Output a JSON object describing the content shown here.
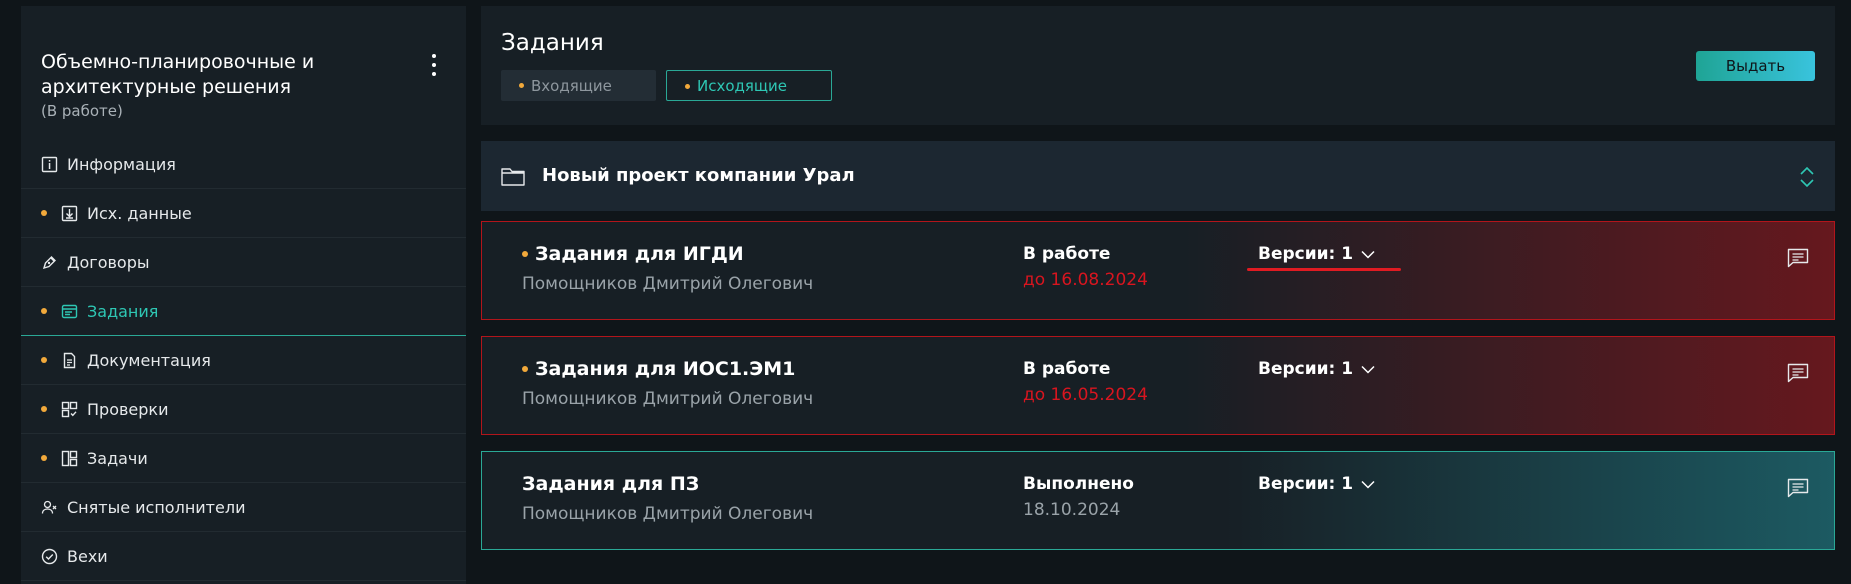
{
  "sidebar": {
    "title": "Объемно-планировочные и архитектурные решения",
    "status": "(В работе)",
    "items": [
      {
        "label": "Информация",
        "dot": false,
        "icon": "info-icon",
        "active": false
      },
      {
        "label": "Исх. данные",
        "dot": true,
        "icon": "download-icon",
        "active": false
      },
      {
        "label": "Договоры",
        "dot": false,
        "icon": "pen-icon",
        "active": false
      },
      {
        "label": "Задания",
        "dot": true,
        "icon": "tasks-window-icon",
        "active": true
      },
      {
        "label": "Документация",
        "dot": true,
        "icon": "document-icon",
        "active": false
      },
      {
        "label": "Проверки",
        "dot": true,
        "icon": "grid-check-icon",
        "active": false
      },
      {
        "label": "Задачи",
        "dot": true,
        "icon": "board-icon",
        "active": false
      },
      {
        "label": "Снятые исполнители",
        "dot": false,
        "icon": "user-remove-icon",
        "active": false
      },
      {
        "label": "Вехи",
        "dot": false,
        "icon": "check-circle-icon",
        "active": false
      }
    ]
  },
  "header": {
    "title": "Задания",
    "tabs": [
      {
        "label": "Входящие",
        "active": false
      },
      {
        "label": "Исходящие",
        "active": true
      }
    ],
    "issue_button": "Выдать"
  },
  "project": {
    "name": "Новый проект компании Урал"
  },
  "tasks": [
    {
      "name": "Задания для ИГДИ",
      "person": "Помощников Дмитрий Олегович",
      "status": "В работе",
      "deadline": "до 16.08.2024",
      "versions": "Версии: 1",
      "dot": true
    },
    {
      "name": "Задания для ИОС1.ЭМ1",
      "person": "Помощников Дмитрий Олегович",
      "status": "В работе",
      "deadline": "до 16.05.2024",
      "versions": "Версии: 1",
      "dot": true
    },
    {
      "name": "Задания для ПЗ",
      "person": "Помощников Дмитрий Олегович",
      "status": "Выполнено",
      "deadline": "18.10.2024",
      "versions": "Версии: 1",
      "dot": false
    }
  ],
  "colors": {
    "accent": "#2ec7b4",
    "warning_dot": "#f2a93b",
    "overdue": "#d8151f",
    "card_border_overdue": "#b2151b",
    "card_border_done": "#2aa896",
    "underline_mark": "#e01b22"
  }
}
